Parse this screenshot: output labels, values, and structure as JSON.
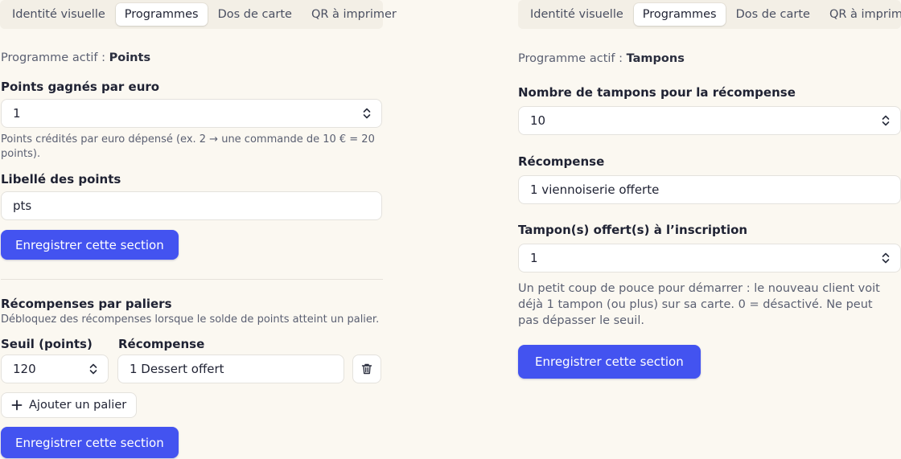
{
  "tabs": [
    "Identité visuelle",
    "Programmes",
    "Dos de carte",
    "QR à imprimer"
  ],
  "active_tab": "Programmes",
  "left": {
    "active_prefix": "Programme actif : ",
    "active_program": "Points",
    "points_per_euro_label": "Points gagnés par euro",
    "points_per_euro_value": "1",
    "points_per_euro_help": "Points crédités par euro dépensé (ex. 2 → une commande de 10 € = 20 points).",
    "points_label_label": "Libellé des points",
    "points_label_value": "pts",
    "save_label": "Enregistrer cette section",
    "tiers_title": "Récompenses par paliers",
    "tiers_help": "Débloquez des récompenses lorsque le solde de points atteint un palier.",
    "threshold_col": "Seuil (points)",
    "reward_col": "Récompense",
    "tiers": [
      {
        "threshold": "120",
        "reward": "1 Dessert offert"
      }
    ],
    "add_tier_label": "Ajouter un palier",
    "save_label_2": "Enregistrer cette section"
  },
  "right": {
    "active_prefix": "Programme actif : ",
    "active_program": "Tampons",
    "stamps_label": "Nombre de tampons pour la récompense",
    "stamps_value": "10",
    "reward_label": "Récompense",
    "reward_value": "1 viennoiserie offerte",
    "signup_label": "Tampon(s) offert(s) à l’inscription",
    "signup_value": "1",
    "signup_help": "Un petit coup de pouce pour démarrer : le nouveau client voit déjà 1 tampon (ou plus) sur sa carte. 0 = désactivé. Ne peut pas dépasser le seuil.",
    "save_label": "Enregistrer cette section"
  },
  "icons": {
    "stepper": "chevron-up-down-icon",
    "trash": "trash-icon",
    "plus": "plus-icon"
  },
  "colors": {
    "primary": "#4353f0",
    "background": "#fbf8f1"
  }
}
